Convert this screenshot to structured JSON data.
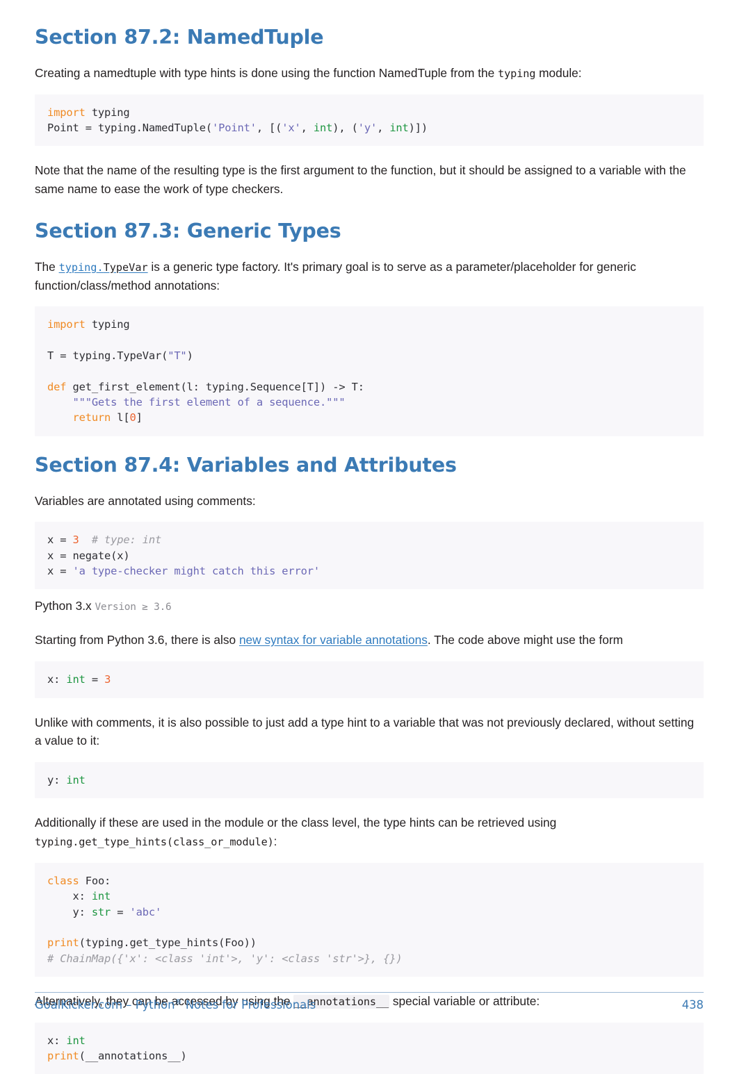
{
  "page": {
    "number": "438",
    "footer_title": "GoalKicker.com – Python® Notes for Professionals",
    "footer_brand": "GoalKicker.com – Python",
    "footer_reg": "®",
    "footer_rest": " Notes for Professionals"
  },
  "sections": [
    {
      "id": "87-2",
      "heading": "Section 87.2: NamedTuple",
      "intro_before": "Creating a namedtuple with type hints is done using the function NamedTuple from the ",
      "intro_code": "typing",
      "intro_after": " module:",
      "code": {
        "lines": [
          [
            {
              "t": "import",
              "c": "kw"
            },
            {
              "t": " typing",
              "c": "plain"
            }
          ],
          [
            {
              "t": "Point = typing.NamedTuple(",
              "c": "plain"
            },
            {
              "t": "'Point'",
              "c": "str"
            },
            {
              "t": ", [(",
              "c": "plain"
            },
            {
              "t": "'x'",
              "c": "str"
            },
            {
              "t": ", ",
              "c": "plain"
            },
            {
              "t": "int",
              "c": "builtin"
            },
            {
              "t": "), (",
              "c": "plain"
            },
            {
              "t": "'y'",
              "c": "str"
            },
            {
              "t": ", ",
              "c": "plain"
            },
            {
              "t": "int",
              "c": "builtin"
            },
            {
              "t": ")])",
              "c": "plain"
            }
          ]
        ]
      },
      "note": "Note that the name of the resulting type is the first argument to the function, but it should be assigned to a variable with the same name to ease the work of type checkers."
    },
    {
      "id": "87-3",
      "heading": "Section 87.3: Generic Types",
      "para_before": "The ",
      "link_mono_blue": "typing.",
      "link_mono_dark": "TypeVar",
      "para_after": " is a generic type factory. It's primary goal is to serve as a parameter/placeholder for generic function/class/method annotations:",
      "code": {
        "lines": [
          [
            {
              "t": "import",
              "c": "kw"
            },
            {
              "t": " typing",
              "c": "plain"
            }
          ],
          [],
          [
            {
              "t": "T = typing.TypeVar(",
              "c": "plain"
            },
            {
              "t": "\"T\"",
              "c": "str"
            },
            {
              "t": ")",
              "c": "plain"
            }
          ],
          [],
          [
            {
              "t": "def",
              "c": "kw"
            },
            {
              "t": " get_first_element(l: typing.Sequence[T]) -> T:",
              "c": "plain"
            }
          ],
          [
            {
              "t": "    ",
              "c": "plain"
            },
            {
              "t": "\"\"\"Gets the first element of a sequence.\"\"\"",
              "c": "str"
            }
          ],
          [
            {
              "t": "    ",
              "c": "plain"
            },
            {
              "t": "return",
              "c": "kw"
            },
            {
              "t": " l[",
              "c": "plain"
            },
            {
              "t": "0",
              "c": "num"
            },
            {
              "t": "]",
              "c": "plain"
            }
          ]
        ]
      }
    },
    {
      "id": "87-4",
      "heading": "Section 87.4: Variables and Attributes",
      "para_1": "Variables are annotated using comments:",
      "code_1": {
        "lines": [
          [
            {
              "t": "x = ",
              "c": "plain"
            },
            {
              "t": "3",
              "c": "num"
            },
            {
              "t": "  ",
              "c": "plain"
            },
            {
              "t": "# type: int",
              "c": "comment"
            }
          ],
          [
            {
              "t": "x = negate(x)",
              "c": "plain"
            }
          ],
          [
            {
              "t": "x = ",
              "c": "plain"
            },
            {
              "t": "'a type-checker might catch this error'",
              "c": "str"
            }
          ]
        ]
      },
      "version_main": "Python 3.x",
      "version_sub": "Version ≥ 3.6",
      "para_2_before": "Starting from Python 3.6, there is also ",
      "para_2_link": "new syntax for variable annotations",
      "para_2_after": ". The code above might use the form",
      "code_2": {
        "lines": [
          [
            {
              "t": "x: ",
              "c": "plain"
            },
            {
              "t": "int",
              "c": "builtin"
            },
            {
              "t": " = ",
              "c": "plain"
            },
            {
              "t": "3",
              "c": "num"
            }
          ]
        ]
      },
      "para_3": "Unlike with comments, it is also possible to just add a type hint to a variable that was not previously declared, without setting a value to it:",
      "code_3": {
        "lines": [
          [
            {
              "t": "y: ",
              "c": "plain"
            },
            {
              "t": "int",
              "c": "builtin"
            }
          ]
        ]
      },
      "para_4_line1": "Additionally if these are used in the module or the class level, the type hints can be retrieved using",
      "para_4_code": "typing.get_type_hints(class_or_module)",
      "para_4_colon": ":",
      "code_4": {
        "lines": [
          [
            {
              "t": "class",
              "c": "kw"
            },
            {
              "t": " Foo:",
              "c": "plain"
            }
          ],
          [
            {
              "t": "    x: ",
              "c": "plain"
            },
            {
              "t": "int",
              "c": "builtin"
            }
          ],
          [
            {
              "t": "    y: ",
              "c": "plain"
            },
            {
              "t": "str",
              "c": "builtin"
            },
            {
              "t": " = ",
              "c": "plain"
            },
            {
              "t": "'abc'",
              "c": "str"
            }
          ],
          [],
          [
            {
              "t": "print",
              "c": "kw"
            },
            {
              "t": "(typing.get_type_hints(Foo))",
              "c": "plain"
            }
          ],
          [
            {
              "t": "# ChainMap({'x': <class 'int'>, 'y': <class 'str'>}, {})",
              "c": "comment"
            }
          ]
        ]
      },
      "para_5_before": "Alternatively, they can be accessed by using the ",
      "para_5_code": "__annotations__",
      "para_5_after": " special variable or attribute:",
      "code_5": {
        "lines": [
          [
            {
              "t": "x: ",
              "c": "plain"
            },
            {
              "t": "int",
              "c": "builtin"
            }
          ],
          [
            {
              "t": "print",
              "c": "kw"
            },
            {
              "t": "(__annotations__)",
              "c": "plain"
            }
          ]
        ]
      }
    }
  ]
}
